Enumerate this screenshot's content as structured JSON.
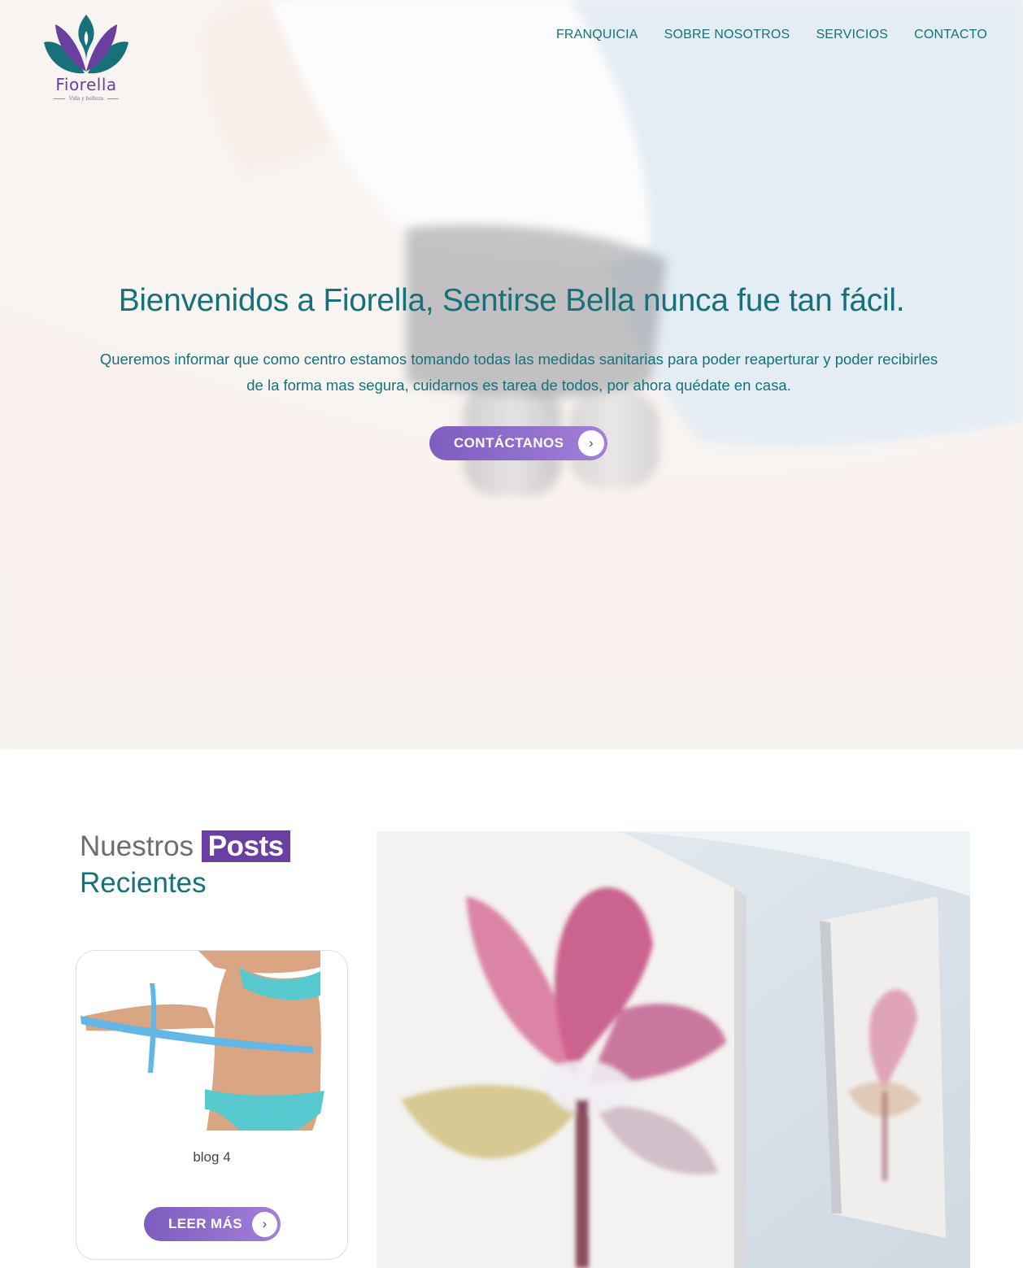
{
  "brand": {
    "name": "Fiorella",
    "tagline": "Vida y belleza",
    "colors": {
      "teal": "#17707a",
      "purple": "#6b3fa0",
      "button_gradient_start": "#7d5dbf",
      "button_gradient_end": "#a37fd8"
    }
  },
  "nav": {
    "items": [
      {
        "label": "FRANQUICIA"
      },
      {
        "label": "SOBRE NOSOTROS"
      },
      {
        "label": "SERVICIOS"
      },
      {
        "label": "CONTACTO"
      }
    ]
  },
  "hero": {
    "title": "Bienvenidos a Fiorella, Sentirse Bella nunca fue tan fácil.",
    "text": "Queremos informar que como centro estamos tomando todas las medidas sanitarias para poder reaperturar y poder recibirles de la forma mas segura, cuidarnos es tarea de todos, por ahora quédate en casa.",
    "button_label": "CONTÁCTANOS",
    "button_icon": "chevron-right-icon"
  },
  "posts": {
    "heading_word1": "Nuestros",
    "heading_highlight": "Posts",
    "heading_line2": "Recientes",
    "cards": [
      {
        "title": "blog 4",
        "button_label": "LEER MÁS",
        "button_icon": "chevron-right-icon"
      }
    ]
  }
}
